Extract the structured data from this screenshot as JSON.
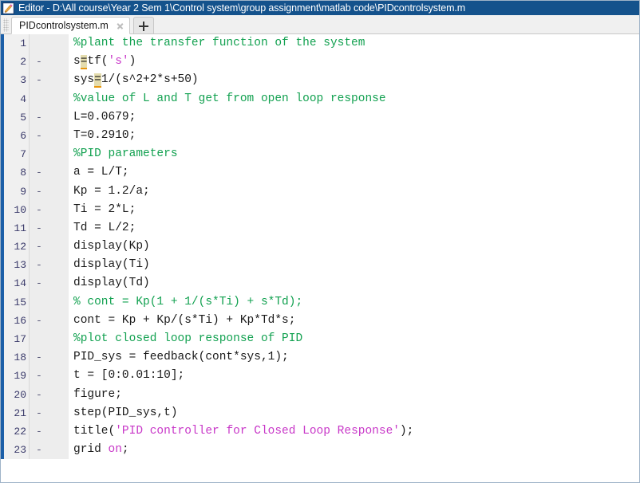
{
  "window": {
    "title": "Editor - D:\\All course\\Year 2 Sem 1\\Control system\\group assignment\\matlab code\\PIDcontrolsystem.m",
    "icon": "matlab-editor-icon",
    "titlebar_color": "#14528c"
  },
  "tabbar": {
    "grip": "drag-grip",
    "tab_label": "PIDcontrolsystem.m",
    "close_icon": "close-icon",
    "add_icon": "add-tab-icon"
  },
  "colors": {
    "comment": "#12a150",
    "string": "#c837c8",
    "plain": "#1a1a1a",
    "highlight_bg": "#e4dcad",
    "highlight_underline": "#e8960f",
    "gutter_bg": "#f0f0f0",
    "line_number": "#3a3a6a"
  },
  "editor": {
    "lines": [
      {
        "num": "1",
        "mark": "",
        "tokens": [
          {
            "t": "comment",
            "s": "%plant the transfer function of the system"
          }
        ]
      },
      {
        "num": "2",
        "mark": "-",
        "tokens": [
          {
            "t": "plain",
            "s": "s"
          },
          {
            "t": "hl",
            "s": "="
          },
          {
            "t": "plain",
            "s": "tf("
          },
          {
            "t": "string",
            "s": "'s'"
          },
          {
            "t": "plain",
            "s": ")"
          }
        ]
      },
      {
        "num": "3",
        "mark": "-",
        "tokens": [
          {
            "t": "plain",
            "s": "sys"
          },
          {
            "t": "hl",
            "s": "="
          },
          {
            "t": "plain",
            "s": "1/(s^2+2*s+50)"
          }
        ]
      },
      {
        "num": "4",
        "mark": "",
        "tokens": [
          {
            "t": "comment",
            "s": "%value of L and T get from open loop response"
          }
        ]
      },
      {
        "num": "5",
        "mark": "-",
        "tokens": [
          {
            "t": "plain",
            "s": "L=0.0679;"
          }
        ]
      },
      {
        "num": "6",
        "mark": "-",
        "tokens": [
          {
            "t": "plain",
            "s": "T=0.2910;"
          }
        ]
      },
      {
        "num": "7",
        "mark": "",
        "tokens": [
          {
            "t": "comment",
            "s": "%PID parameters"
          }
        ]
      },
      {
        "num": "8",
        "mark": "-",
        "tokens": [
          {
            "t": "plain",
            "s": "a = L/T;"
          }
        ]
      },
      {
        "num": "9",
        "mark": "-",
        "tokens": [
          {
            "t": "plain",
            "s": "Kp = 1.2/a;"
          }
        ]
      },
      {
        "num": "10",
        "mark": "-",
        "tokens": [
          {
            "t": "plain",
            "s": "Ti = 2*L;"
          }
        ]
      },
      {
        "num": "11",
        "mark": "-",
        "tokens": [
          {
            "t": "plain",
            "s": "Td = L/2;"
          }
        ]
      },
      {
        "num": "12",
        "mark": "-",
        "tokens": [
          {
            "t": "plain",
            "s": "display(Kp)"
          }
        ]
      },
      {
        "num": "13",
        "mark": "-",
        "tokens": [
          {
            "t": "plain",
            "s": "display(Ti)"
          }
        ]
      },
      {
        "num": "14",
        "mark": "-",
        "tokens": [
          {
            "t": "plain",
            "s": "display(Td)"
          }
        ]
      },
      {
        "num": "15",
        "mark": "",
        "tokens": [
          {
            "t": "comment",
            "s": "% cont = Kp(1 + 1/(s*Ti) + s*Td);"
          }
        ]
      },
      {
        "num": "16",
        "mark": "-",
        "tokens": [
          {
            "t": "plain",
            "s": "cont = Kp + Kp/(s*Ti) + Kp*Td*s;"
          }
        ]
      },
      {
        "num": "17",
        "mark": "",
        "tokens": [
          {
            "t": "comment",
            "s": "%plot closed loop response of PID"
          }
        ]
      },
      {
        "num": "18",
        "mark": "-",
        "tokens": [
          {
            "t": "plain",
            "s": "PID_sys = feedback(cont*sys,1);"
          }
        ]
      },
      {
        "num": "19",
        "mark": "-",
        "tokens": [
          {
            "t": "plain",
            "s": "t = [0:0.01:10];"
          }
        ]
      },
      {
        "num": "20",
        "mark": "-",
        "tokens": [
          {
            "t": "plain",
            "s": "figure;"
          }
        ]
      },
      {
        "num": "21",
        "mark": "-",
        "tokens": [
          {
            "t": "plain",
            "s": "step(PID_sys,t)"
          }
        ]
      },
      {
        "num": "22",
        "mark": "-",
        "tokens": [
          {
            "t": "plain",
            "s": "title("
          },
          {
            "t": "string",
            "s": "'PID controller for Closed Loop Response'"
          },
          {
            "t": "plain",
            "s": ");"
          }
        ]
      },
      {
        "num": "23",
        "mark": "-",
        "tokens": [
          {
            "t": "plain",
            "s": "grid "
          },
          {
            "t": "string",
            "s": "on"
          },
          {
            "t": "plain",
            "s": ";"
          }
        ]
      }
    ]
  }
}
